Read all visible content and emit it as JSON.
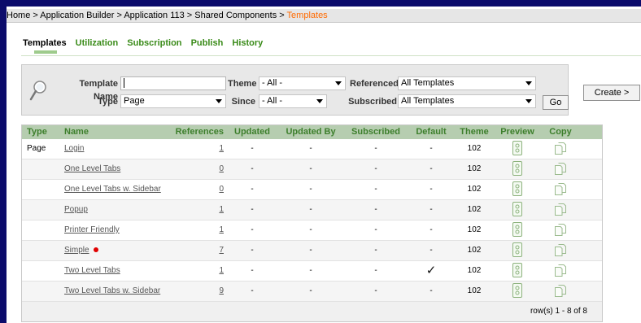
{
  "breadcrumb": {
    "items": [
      "Home",
      "Application Builder",
      "Application 113",
      "Shared Components"
    ],
    "separator": " > ",
    "current": "Templates"
  },
  "tabs": [
    "Templates",
    "Utilization",
    "Subscription",
    "Publish",
    "History"
  ],
  "active_tab": "Templates",
  "search": {
    "template_name_label": "Template Name",
    "template_name_value": "",
    "theme_label": "Theme",
    "theme_value": "- All -",
    "referenced_label": "Referenced",
    "referenced_value": "All Templates",
    "type_label": "Type",
    "type_value": "Page",
    "since_label": "Since",
    "since_value": "- All -",
    "subscribed_label": "Subscribed",
    "subscribed_value": "All Templates",
    "go_label": "Go"
  },
  "create_label": "Create >",
  "table": {
    "columns": [
      "Type",
      "Name",
      "References",
      "Updated",
      "Updated By",
      "Subscribed",
      "Default",
      "Theme",
      "Preview",
      "Copy"
    ],
    "rows": [
      {
        "type": "Page",
        "name": "Login",
        "references": "1",
        "updated": "-",
        "updated_by": "-",
        "subscribed": "-",
        "default": "-",
        "theme": "102"
      },
      {
        "type": "",
        "name": "One Level Tabs",
        "references": "0",
        "updated": "-",
        "updated_by": "-",
        "subscribed": "-",
        "default": "-",
        "theme": "102"
      },
      {
        "type": "",
        "name": "One Level Tabs w. Sidebar",
        "references": "0",
        "updated": "-",
        "updated_by": "-",
        "subscribed": "-",
        "default": "-",
        "theme": "102"
      },
      {
        "type": "",
        "name": "Popup",
        "references": "1",
        "updated": "-",
        "updated_by": "-",
        "subscribed": "-",
        "default": "-",
        "theme": "102"
      },
      {
        "type": "",
        "name": "Printer Friendly",
        "references": "1",
        "updated": "-",
        "updated_by": "-",
        "subscribed": "-",
        "default": "-",
        "theme": "102"
      },
      {
        "type": "",
        "name": "Simple",
        "references": "7",
        "updated": "-",
        "updated_by": "-",
        "subscribed": "-",
        "default": "-",
        "theme": "102",
        "marker": true
      },
      {
        "type": "",
        "name": "Two Level Tabs",
        "references": "1",
        "updated": "-",
        "updated_by": "-",
        "subscribed": "-",
        "default": "✓",
        "theme": "102"
      },
      {
        "type": "",
        "name": "Two Level Tabs w. Sidebar",
        "references": "9",
        "updated": "-",
        "updated_by": "-",
        "subscribed": "-",
        "default": "-",
        "theme": "102"
      }
    ],
    "footer": "row(s) 1 - 8 of 8"
  },
  "icons": {
    "search": "magnifier-icon",
    "preview": "preview-icon",
    "copy": "copy-icon"
  },
  "colors": {
    "breadcrumb_current": "#ff6a00",
    "tab_green": "#3a8b19",
    "header_bg": "#b6cdb0",
    "header_text": "#3d7f2c",
    "frame": "#0b0b6b"
  }
}
